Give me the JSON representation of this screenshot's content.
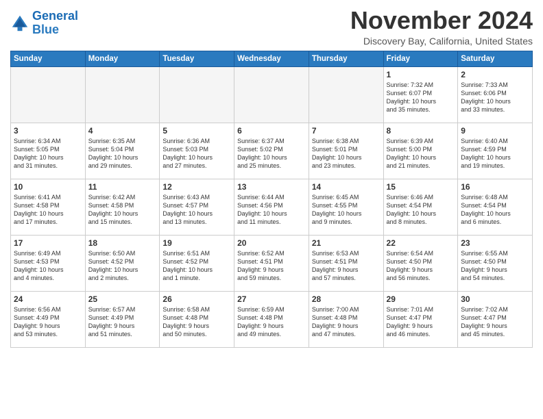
{
  "header": {
    "logo_line1": "General",
    "logo_line2": "Blue",
    "month_year": "November 2024",
    "location": "Discovery Bay, California, United States"
  },
  "weekdays": [
    "Sunday",
    "Monday",
    "Tuesday",
    "Wednesday",
    "Thursday",
    "Friday",
    "Saturday"
  ],
  "weeks": [
    [
      {
        "day": "",
        "content": ""
      },
      {
        "day": "",
        "content": ""
      },
      {
        "day": "",
        "content": ""
      },
      {
        "day": "",
        "content": ""
      },
      {
        "day": "",
        "content": ""
      },
      {
        "day": "1",
        "content": "Sunrise: 7:32 AM\nSunset: 6:07 PM\nDaylight: 10 hours\nand 35 minutes."
      },
      {
        "day": "2",
        "content": "Sunrise: 7:33 AM\nSunset: 6:06 PM\nDaylight: 10 hours\nand 33 minutes."
      }
    ],
    [
      {
        "day": "3",
        "content": "Sunrise: 6:34 AM\nSunset: 5:05 PM\nDaylight: 10 hours\nand 31 minutes."
      },
      {
        "day": "4",
        "content": "Sunrise: 6:35 AM\nSunset: 5:04 PM\nDaylight: 10 hours\nand 29 minutes."
      },
      {
        "day": "5",
        "content": "Sunrise: 6:36 AM\nSunset: 5:03 PM\nDaylight: 10 hours\nand 27 minutes."
      },
      {
        "day": "6",
        "content": "Sunrise: 6:37 AM\nSunset: 5:02 PM\nDaylight: 10 hours\nand 25 minutes."
      },
      {
        "day": "7",
        "content": "Sunrise: 6:38 AM\nSunset: 5:01 PM\nDaylight: 10 hours\nand 23 minutes."
      },
      {
        "day": "8",
        "content": "Sunrise: 6:39 AM\nSunset: 5:00 PM\nDaylight: 10 hours\nand 21 minutes."
      },
      {
        "day": "9",
        "content": "Sunrise: 6:40 AM\nSunset: 4:59 PM\nDaylight: 10 hours\nand 19 minutes."
      }
    ],
    [
      {
        "day": "10",
        "content": "Sunrise: 6:41 AM\nSunset: 4:58 PM\nDaylight: 10 hours\nand 17 minutes."
      },
      {
        "day": "11",
        "content": "Sunrise: 6:42 AM\nSunset: 4:58 PM\nDaylight: 10 hours\nand 15 minutes."
      },
      {
        "day": "12",
        "content": "Sunrise: 6:43 AM\nSunset: 4:57 PM\nDaylight: 10 hours\nand 13 minutes."
      },
      {
        "day": "13",
        "content": "Sunrise: 6:44 AM\nSunset: 4:56 PM\nDaylight: 10 hours\nand 11 minutes."
      },
      {
        "day": "14",
        "content": "Sunrise: 6:45 AM\nSunset: 4:55 PM\nDaylight: 10 hours\nand 9 minutes."
      },
      {
        "day": "15",
        "content": "Sunrise: 6:46 AM\nSunset: 4:54 PM\nDaylight: 10 hours\nand 8 minutes."
      },
      {
        "day": "16",
        "content": "Sunrise: 6:48 AM\nSunset: 4:54 PM\nDaylight: 10 hours\nand 6 minutes."
      }
    ],
    [
      {
        "day": "17",
        "content": "Sunrise: 6:49 AM\nSunset: 4:53 PM\nDaylight: 10 hours\nand 4 minutes."
      },
      {
        "day": "18",
        "content": "Sunrise: 6:50 AM\nSunset: 4:52 PM\nDaylight: 10 hours\nand 2 minutes."
      },
      {
        "day": "19",
        "content": "Sunrise: 6:51 AM\nSunset: 4:52 PM\nDaylight: 10 hours\nand 1 minute."
      },
      {
        "day": "20",
        "content": "Sunrise: 6:52 AM\nSunset: 4:51 PM\nDaylight: 9 hours\nand 59 minutes."
      },
      {
        "day": "21",
        "content": "Sunrise: 6:53 AM\nSunset: 4:51 PM\nDaylight: 9 hours\nand 57 minutes."
      },
      {
        "day": "22",
        "content": "Sunrise: 6:54 AM\nSunset: 4:50 PM\nDaylight: 9 hours\nand 56 minutes."
      },
      {
        "day": "23",
        "content": "Sunrise: 6:55 AM\nSunset: 4:50 PM\nDaylight: 9 hours\nand 54 minutes."
      }
    ],
    [
      {
        "day": "24",
        "content": "Sunrise: 6:56 AM\nSunset: 4:49 PM\nDaylight: 9 hours\nand 53 minutes."
      },
      {
        "day": "25",
        "content": "Sunrise: 6:57 AM\nSunset: 4:49 PM\nDaylight: 9 hours\nand 51 minutes."
      },
      {
        "day": "26",
        "content": "Sunrise: 6:58 AM\nSunset: 4:48 PM\nDaylight: 9 hours\nand 50 minutes."
      },
      {
        "day": "27",
        "content": "Sunrise: 6:59 AM\nSunset: 4:48 PM\nDaylight: 9 hours\nand 49 minutes."
      },
      {
        "day": "28",
        "content": "Sunrise: 7:00 AM\nSunset: 4:48 PM\nDaylight: 9 hours\nand 47 minutes."
      },
      {
        "day": "29",
        "content": "Sunrise: 7:01 AM\nSunset: 4:47 PM\nDaylight: 9 hours\nand 46 minutes."
      },
      {
        "day": "30",
        "content": "Sunrise: 7:02 AM\nSunset: 4:47 PM\nDaylight: 9 hours\nand 45 minutes."
      }
    ]
  ]
}
